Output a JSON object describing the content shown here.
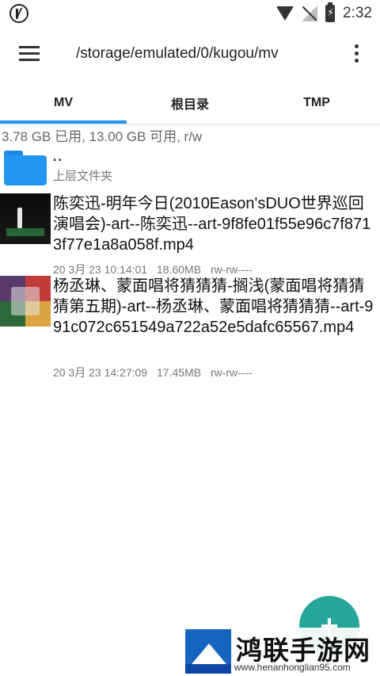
{
  "status_bar": {
    "time": "2:32",
    "left_icon": "k-logo-icon",
    "icons": [
      "wifi-icon",
      "no-signal-icon",
      "battery-icon"
    ],
    "battery_glyph": "⚡"
  },
  "toolbar": {
    "path": "/storage/emulated/0/kugou/mv",
    "menu_icon": "hamburger-menu-icon",
    "more_icon": "more-vertical-icon"
  },
  "tabs": [
    {
      "label": "MV",
      "active": true
    },
    {
      "label": "根目录",
      "active": false
    },
    {
      "label": "TMP",
      "active": false
    }
  ],
  "storage_info": "3.78 GB 已用, 13.00 GB 可用, r/w",
  "parent_folder": {
    "name": "..",
    "label": "上层文件夹",
    "icon": "folder-icon"
  },
  "files": [
    {
      "name": "陈奕迅-明年今日(2010Eason'sDUO世界巡回演唱会)-art--陈奕迅--art-9f8fe01f55e96c7f8713f77e1a8a058f.mp4",
      "date": "20 3月 23 10:14:01",
      "size": "18.60MB",
      "permissions": "rw-rw----"
    },
    {
      "name": "杨丞琳、蒙面唱将猜猜猜-搁浅(蒙面唱将猜猜猜第五期)-art--杨丞琳、蒙面唱将猜猜猜--art-991c072c651549a722a52e5dafc65567.mp4",
      "date": "20 3月 23 14:27:09",
      "size": "17.45MB",
      "permissions": "rw-rw----"
    }
  ],
  "fab": {
    "icon": "add-icon"
  },
  "watermark": {
    "title": "鸿联手游网",
    "url": "www.henanhonglian95.com"
  },
  "colors": {
    "accent": "#2196f3",
    "fab": "#26a69a",
    "folder": "#2196f3"
  }
}
